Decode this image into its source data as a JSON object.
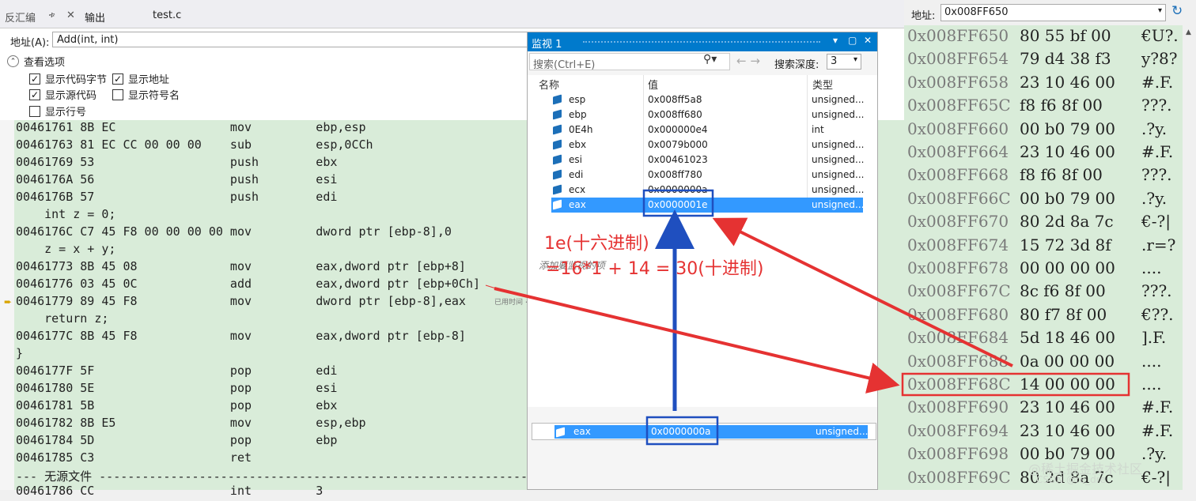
{
  "tabs": {
    "disassembly": "反汇编",
    "pin": "ቱ",
    "close": "✕",
    "output": "输出",
    "file": "test.c"
  },
  "address": {
    "label": "地址(A):",
    "value": "Add(int, int)"
  },
  "view_options": {
    "header": "查看选项",
    "options": [
      {
        "label": "显示代码字节",
        "checked": true
      },
      {
        "label": "显示地址",
        "checked": true
      },
      {
        "label": "显示源代码",
        "checked": true
      },
      {
        "label": "显示符号名",
        "checked": false
      },
      {
        "label": "显示行号",
        "checked": false
      }
    ]
  },
  "code_lines": [
    "00461761 8B EC                mov         ebp,esp",
    "00461763 81 EC CC 00 00 00    sub         esp,0CCh",
    "00461769 53                   push        ebx",
    "0046176A 56                   push        esi",
    "0046176B 57                   push        edi",
    "    int z = 0;",
    "0046176C C7 45 F8 00 00 00 00 mov         dword ptr [ebp-8],0",
    "    z = x + y;",
    "00461773 8B 45 08             mov         eax,dword ptr [ebp+8]",
    "00461776 03 45 0C             add         eax,dword ptr [ebp+0Ch]",
    "00461779 89 45 F8             mov         dword ptr [ebp-8],eax",
    "    return z;",
    "0046177C 8B 45 F8             mov         eax,dword ptr [ebp-8]",
    "}",
    "0046177F 5F                   pop         edi",
    "00461780 5E                   pop         esi",
    "00461781 5B                   pop         ebx",
    "00461782 8B E5                mov         esp,ebp",
    "00461784 5D                   pop         ebp",
    "00461785 C3                   ret",
    "--- 无源文件 -----------------------------------------------------------------------------",
    "00461786 CC                   int         3"
  ],
  "used_time_hint": "已用时间 <",
  "watch": {
    "title": "监视 1",
    "search_placeholder": "搜索(Ctrl+E)",
    "depth_label": "搜索深度:",
    "depth_value": "3",
    "columns": {
      "name": "名称",
      "value": "值",
      "type": "类型"
    },
    "rows": [
      {
        "name": "esp",
        "value": "0x008ff5a8",
        "type": "unsigned..."
      },
      {
        "name": "ebp",
        "value": "0x008ff680",
        "type": "unsigned..."
      },
      {
        "name": "0E4h",
        "value": "0x000000e4",
        "type": "int"
      },
      {
        "name": "ebx",
        "value": "0x0079b000",
        "type": "unsigned..."
      },
      {
        "name": "esi",
        "value": "0x00461023",
        "type": "unsigned..."
      },
      {
        "name": "edi",
        "value": "0x008ff780",
        "type": "unsigned..."
      },
      {
        "name": "ecx",
        "value": "0x0000000a",
        "type": "unsigned..."
      },
      {
        "name": "eax",
        "value": "0x0000001e",
        "type": "unsigned..."
      }
    ],
    "add_item": "添加要监视的项"
  },
  "annotations": {
    "line1": "1e(十六进制)",
    "line2": "=16*1 + 14 = 30(十进制)",
    "color": "#e53232",
    "highlight_color": "#1f4fbf"
  },
  "eax_previous": {
    "name": "eax",
    "value": "0x0000000a",
    "type": "unsigned..."
  },
  "memory": {
    "label": "地址:",
    "address": "0x008FF650",
    "rows": [
      {
        "addr": "0x008FF650",
        "bytes": "80 55 bf 00",
        "chars": "€U?."
      },
      {
        "addr": "0x008FF654",
        "bytes": "79 d4 38 f3",
        "chars": "y?8?"
      },
      {
        "addr": "0x008FF658",
        "bytes": "23 10 46 00",
        "chars": "#.F."
      },
      {
        "addr": "0x008FF65C",
        "bytes": "f8 f6 8f 00",
        "chars": "???."
      },
      {
        "addr": "0x008FF660",
        "bytes": "00 b0 79 00",
        "chars": ".?y."
      },
      {
        "addr": "0x008FF664",
        "bytes": "23 10 46 00",
        "chars": "#.F."
      },
      {
        "addr": "0x008FF668",
        "bytes": "f8 f6 8f 00",
        "chars": "???."
      },
      {
        "addr": "0x008FF66C",
        "bytes": "00 b0 79 00",
        "chars": ".?y."
      },
      {
        "addr": "0x008FF670",
        "bytes": "80 2d 8a 7c",
        "chars": "€-?|"
      },
      {
        "addr": "0x008FF674",
        "bytes": "15 72 3d 8f",
        "chars": ".r=?"
      },
      {
        "addr": "0x008FF678",
        "bytes": "00 00 00 00",
        "chars": "...."
      },
      {
        "addr": "0x008FF67C",
        "bytes": "8c f6 8f 00",
        "chars": "???."
      },
      {
        "addr": "0x008FF680",
        "bytes": "80 f7 8f 00",
        "chars": "€??."
      },
      {
        "addr": "0x008FF684",
        "bytes": "5d 18 46 00",
        "chars": "].F."
      },
      {
        "addr": "0x008FF688",
        "bytes": "0a 00 00 00",
        "chars": "...."
      },
      {
        "addr": "0x008FF68C",
        "bytes": "14 00 00 00",
        "chars": "...."
      },
      {
        "addr": "0x008FF690",
        "bytes": "23 10 46 00",
        "chars": "#.F."
      },
      {
        "addr": "0x008FF694",
        "bytes": "23 10 46 00",
        "chars": "#.F."
      },
      {
        "addr": "0x008FF698",
        "bytes": "00 b0 79 00",
        "chars": ".?y."
      },
      {
        "addr": "0x008FF69C",
        "bytes": "80 2d 8a 7c",
        "chars": "€-?|"
      }
    ]
  },
  "watermark": "@稀土掘金技术社区",
  "watermark2": "CSDN @re_dre"
}
